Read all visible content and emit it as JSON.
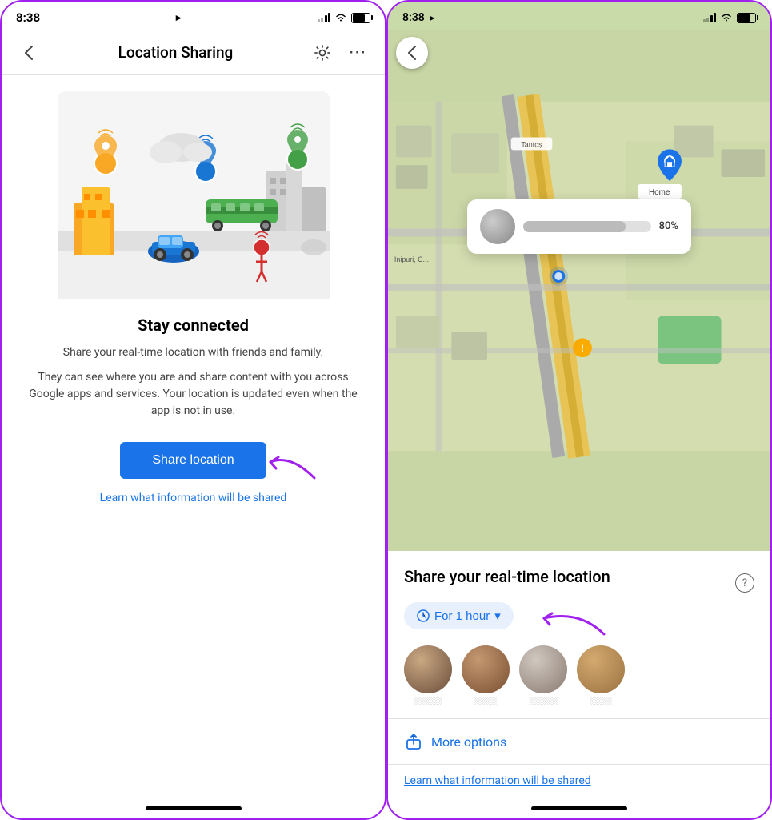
{
  "left": {
    "status": {
      "time": "8:38",
      "location_icon": "▶"
    },
    "nav": {
      "back_label": "‹",
      "title": "Location Sharing",
      "gear_icon": "⚙",
      "more_icon": "⋯"
    },
    "illustration_alt": "Location sharing illustration with people and vehicles",
    "content": {
      "heading": "Stay connected",
      "desc1": "Share your real-time location with friends and family.",
      "desc2": "They can see where you are and share content with you across Google apps and services. Your location is updated even when the app is not in use.",
      "share_button": "Share location",
      "learn_link": "Learn what information will be shared"
    },
    "home_indicator": true
  },
  "right": {
    "status": {
      "time": "8:38",
      "location_icon": "▶"
    },
    "map": {
      "home_label": "Home",
      "battery_pct": "80%",
      "tantop_label": "Tantoṣ",
      "inipuri_label": "Inipuri, C..."
    },
    "bottom_sheet": {
      "title": "Share your real-time location",
      "help_icon": "?",
      "for_hour_label": "For 1 hour",
      "for_hour_arrow": "▾",
      "contacts": [
        {
          "name": "Contact 1",
          "avatar_class": "avatar-1"
        },
        {
          "name": "Contact 2",
          "avatar_class": "avatar-2"
        },
        {
          "name": "Contact 3",
          "avatar_class": "avatar-3"
        },
        {
          "name": "Contact 4",
          "avatar_class": "avatar-4"
        }
      ],
      "more_options_label": "More options",
      "learn_link": "Learn what information will be shared"
    },
    "home_indicator": true
  },
  "colors": {
    "accent": "#1a73e8",
    "purple": "#a020f0",
    "text_primary": "#000",
    "text_secondary": "#444"
  }
}
